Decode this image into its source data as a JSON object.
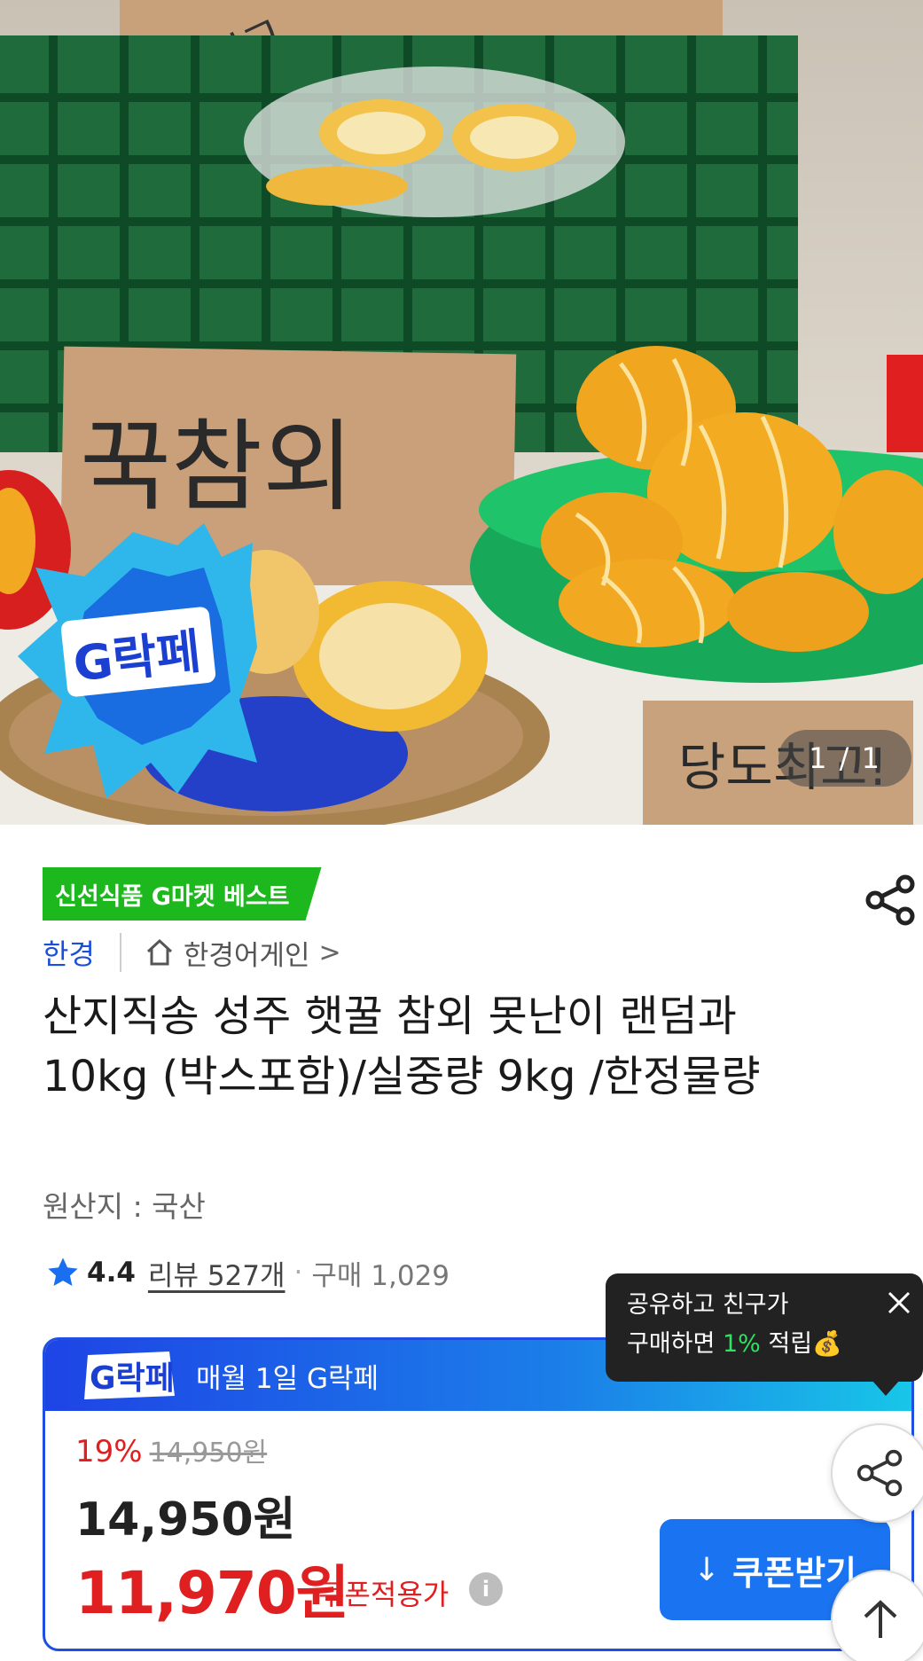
{
  "image": {
    "counter": "1 / 1",
    "sign_main": "꾹참외",
    "sign_top": "당도 최고",
    "sign_bottom": "당도최고!",
    "logo_text": "G락페"
  },
  "badge": {
    "label": "신선식품 G마켓 베스트"
  },
  "brand": {
    "name": "한경",
    "store": "한경어게인",
    "store_chevron": ">"
  },
  "product": {
    "title": "산지직송 성주 햇꿀 참외 못난이 랜덤과 10kg (박스포함)/실중량 9kg /한정물량",
    "origin": "원산지 : 국산"
  },
  "rating": {
    "score": "4.4",
    "reviews": "리뷰 527개",
    "separator": "·",
    "purchases": "구매 1,029"
  },
  "card": {
    "header_logo": "G락페",
    "header_text": "매월 1일 G락페",
    "discount": "19%",
    "original_price": "14,950원",
    "price": "14,950원",
    "coupon_price": "11,970원",
    "coupon_label": "쿠폰적용가",
    "info_icon": "i",
    "coupon_button": "쿠폰받기",
    "coupon_button_icon": "↓"
  },
  "tooltip": {
    "line1": "공유하고 친구가",
    "line2_prefix": "구매하면 ",
    "line2_highlight": "1%",
    "line2_suffix": " 적립💰"
  },
  "colors": {
    "accent_blue": "#1a73f0",
    "brand_blue": "#1c4fd8",
    "sale_red": "#e02020",
    "best_green": "#1db81d",
    "tooltip_highlight": "#2ee35f"
  },
  "icons": {
    "share": "share-icon",
    "home": "home-icon",
    "star": "star-icon",
    "close": "close-icon",
    "scroll_top": "arrow-up-icon",
    "download": "download-icon"
  }
}
